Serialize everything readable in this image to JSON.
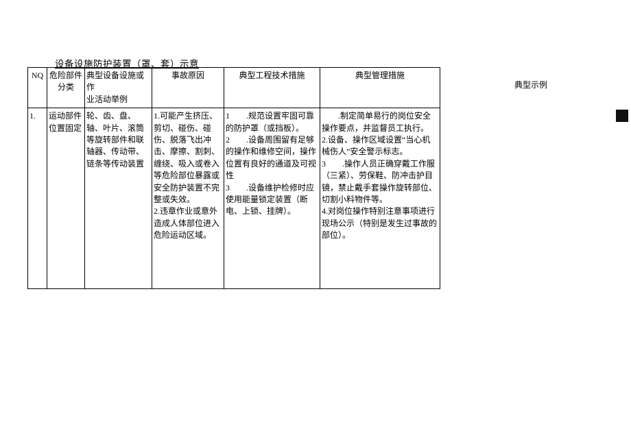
{
  "title": "设备设施防护装置（罩、套）示意",
  "externalHeader": "典型示例",
  "headers": {
    "no": "NQ",
    "category": "危险部件\n分类",
    "example": "典型设备设施或作\n业活动举例",
    "cause": "事故原因",
    "tech": "典型工程技术措施",
    "mgmt": "典型管理措施"
  },
  "row1": {
    "no": "1.",
    "category": "运动部件位置固定",
    "example": "轮、齿、盘、轴、叶片、滚筒等旋转部件和联轴器、传动带、链条等传动装置",
    "cause": "1.可能产生挤压、剪切、碰伤、碰伤、脱落飞出冲击、摩擦、割刺、缠绕、吸入或卷入等危险部位暴露或安全防护装置不完整或失效。\n2.违章作业或意外造成人体部位进入危险运动区域。",
    "tech": "1　　.规范设置牢固可靠的防护罩（或挡板）。\n2　　.设备周围留有足够的操作和维修空间，操作位置有良好的通道及可视性\n3　　.设备维护检修时应使用能量锁定装置（断电、上锁、挂牌）。",
    "mgmt": "　　.制定简单易行的岗位安全操作要点，并监督员工执行。\n2.设备、操作区域设置“当心机械伤人”安全警示标志。\n3　　.操作人员正确穿戴工作服（三紧）、劳保鞋、防冲击护目镜，禁止戴手套操作旋转部位、切割小料物件等。\n4.对岗位操作特别注意事项进行现场公示（特别是发生过事故的部位）。"
  }
}
